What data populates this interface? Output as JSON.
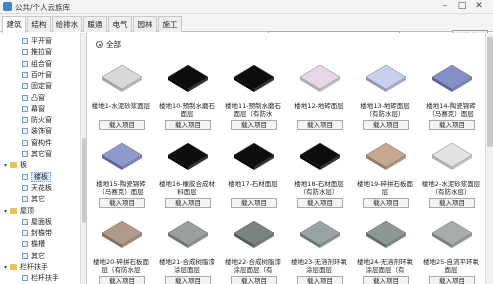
{
  "window": {
    "title": "公共/个人云族库"
  },
  "tabs": [
    "建筑",
    "结构",
    "给排水",
    "暖通",
    "电气",
    "园林",
    "施工"
  ],
  "search": {
    "button_label": "搜索"
  },
  "sidebar": {
    "items": [
      {
        "label": "平开窗",
        "kind": "leaf"
      },
      {
        "label": "推拉窗",
        "kind": "leaf"
      },
      {
        "label": "组合窗",
        "kind": "leaf"
      },
      {
        "label": "百叶窗",
        "kind": "leaf"
      },
      {
        "label": "固定窗",
        "kind": "leaf"
      },
      {
        "label": "凸窗",
        "kind": "leaf"
      },
      {
        "label": "幕窗",
        "kind": "leaf"
      },
      {
        "label": "防火窗",
        "kind": "leaf"
      },
      {
        "label": "装饰窗",
        "kind": "leaf"
      },
      {
        "label": "窗构件",
        "kind": "leaf"
      },
      {
        "label": "其它窗",
        "kind": "leaf"
      },
      {
        "label": "板",
        "kind": "group"
      },
      {
        "label": "楼板",
        "kind": "leaf",
        "selected": true
      },
      {
        "label": "天花板",
        "kind": "leaf"
      },
      {
        "label": "其它",
        "kind": "leaf"
      },
      {
        "label": "屋顶",
        "kind": "group"
      },
      {
        "label": "屋面板",
        "kind": "leaf"
      },
      {
        "label": "封檐带",
        "kind": "leaf"
      },
      {
        "label": "檐槽",
        "kind": "leaf"
      },
      {
        "label": "其它",
        "kind": "leaf"
      },
      {
        "label": "栏杆扶手",
        "kind": "group"
      },
      {
        "label": "栏杆扶手",
        "kind": "leaf"
      }
    ]
  },
  "filter": {
    "all_label": "全部"
  },
  "load_label": "载入项目",
  "items": [
    {
      "name": "楼地1-水泥砂浆面层",
      "color": "#d8d8d8",
      "dark": "#a8a8a8"
    },
    {
      "name": "楼地10-预制水磨石面层",
      "color": "#0d0d0d",
      "dark": "#000000"
    },
    {
      "name": "楼地11-预制水磨石面层（有防水",
      "color": "#0d0d0d",
      "dark": "#000000"
    },
    {
      "name": "楼地12-地砖面层",
      "color": "#e6d6e6",
      "dark": "#b8a8b8"
    },
    {
      "name": "楼地13-地砖面层（有防水层）",
      "color": "#c8d0ee",
      "dark": "#9098c0"
    },
    {
      "name": "楼地14-陶瓷锦砖（马赛克）面层",
      "color": "#8690c8",
      "dark": "#5a6498"
    },
    {
      "name": "楼地15-陶瓷锦砖（马赛克）面层",
      "color": "#9098cc",
      "dark": "#5e6698"
    },
    {
      "name": "楼地16-橡胶合成材料面层",
      "color": "#0d0d0d",
      "dark": "#000000"
    },
    {
      "name": "楼地17-石材面层",
      "color": "#0d0d0d",
      "dark": "#000000"
    },
    {
      "name": "楼地18-石材面层（有防水层）",
      "color": "#0d0d0d",
      "dark": "#000000"
    },
    {
      "name": "楼地19-碎拼石板面层",
      "color": "#c6a890",
      "dark": "#987a64"
    },
    {
      "name": "楼地2-水泥砂浆面层（有防水层）",
      "color": "#e2e2e2",
      "dark": "#b0b0b0"
    },
    {
      "name": "楼地20-碎拼石板面层（有防水层",
      "color": "#b09a8a",
      "dark": "#86705e"
    },
    {
      "name": "楼地21-合成树脂漆涂层面层",
      "color": "#9aa0a0",
      "dark": "#6e7474"
    },
    {
      "name": "楼地22-合成树脂漆涂层面层（有",
      "color": "#7a8282",
      "dark": "#545a5a"
    },
    {
      "name": "楼地23-无溶剂环氧涂层面层",
      "color": "#9aa4a4",
      "dark": "#6c7676"
    },
    {
      "name": "楼地24-无溶剂环氧涂层面层（有",
      "color": "#8e9696",
      "dark": "#626a6a"
    },
    {
      "name": "楼地25-自流平环氧面层",
      "color": "#a6acac",
      "dark": "#7a8080"
    }
  ]
}
